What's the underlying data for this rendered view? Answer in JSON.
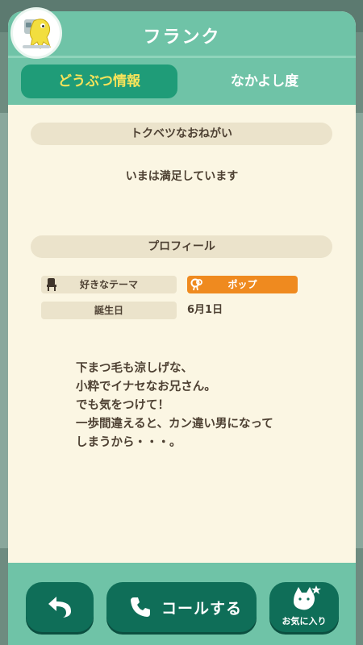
{
  "header": {
    "title": "フランク"
  },
  "tabs": [
    {
      "label": "どうぶつ情報",
      "active": true
    },
    {
      "label": "なかよし度",
      "active": false
    }
  ],
  "wish": {
    "heading": "トクベツなおねがい",
    "text": "いまは満足しています"
  },
  "profile": {
    "heading": "プロフィール",
    "theme_label": "好きなテーマ",
    "theme_value": "ポップ",
    "birthday_label": "誕生日",
    "birthday_value": "6月1日",
    "bio_lines": [
      "下まつ毛も涼しげな、",
      "小粋でイナセなお兄さん。",
      "でも気をつけて！",
      "一歩間違えると、カン違い男になって",
      "しまうから・・・。"
    ]
  },
  "bottom_bar": {
    "call_label": "コールする",
    "favorite_label": "お気に入り"
  },
  "colors": {
    "header": "#6fc3a7",
    "active_tab": "#1f9c78",
    "active_tab_text": "#f7e35a",
    "card": "#fbf6e3",
    "pill": "#ebe3cb",
    "theme_badge": "#ef8a1f",
    "button": "#0f6e58"
  },
  "icons": {
    "avatar": "villager-avatar",
    "theme_label": "chair-icon",
    "theme_value": "pop-icon",
    "back": "back-arrow-icon",
    "call": "phone-icon",
    "favorite": "cat-star-icon"
  }
}
